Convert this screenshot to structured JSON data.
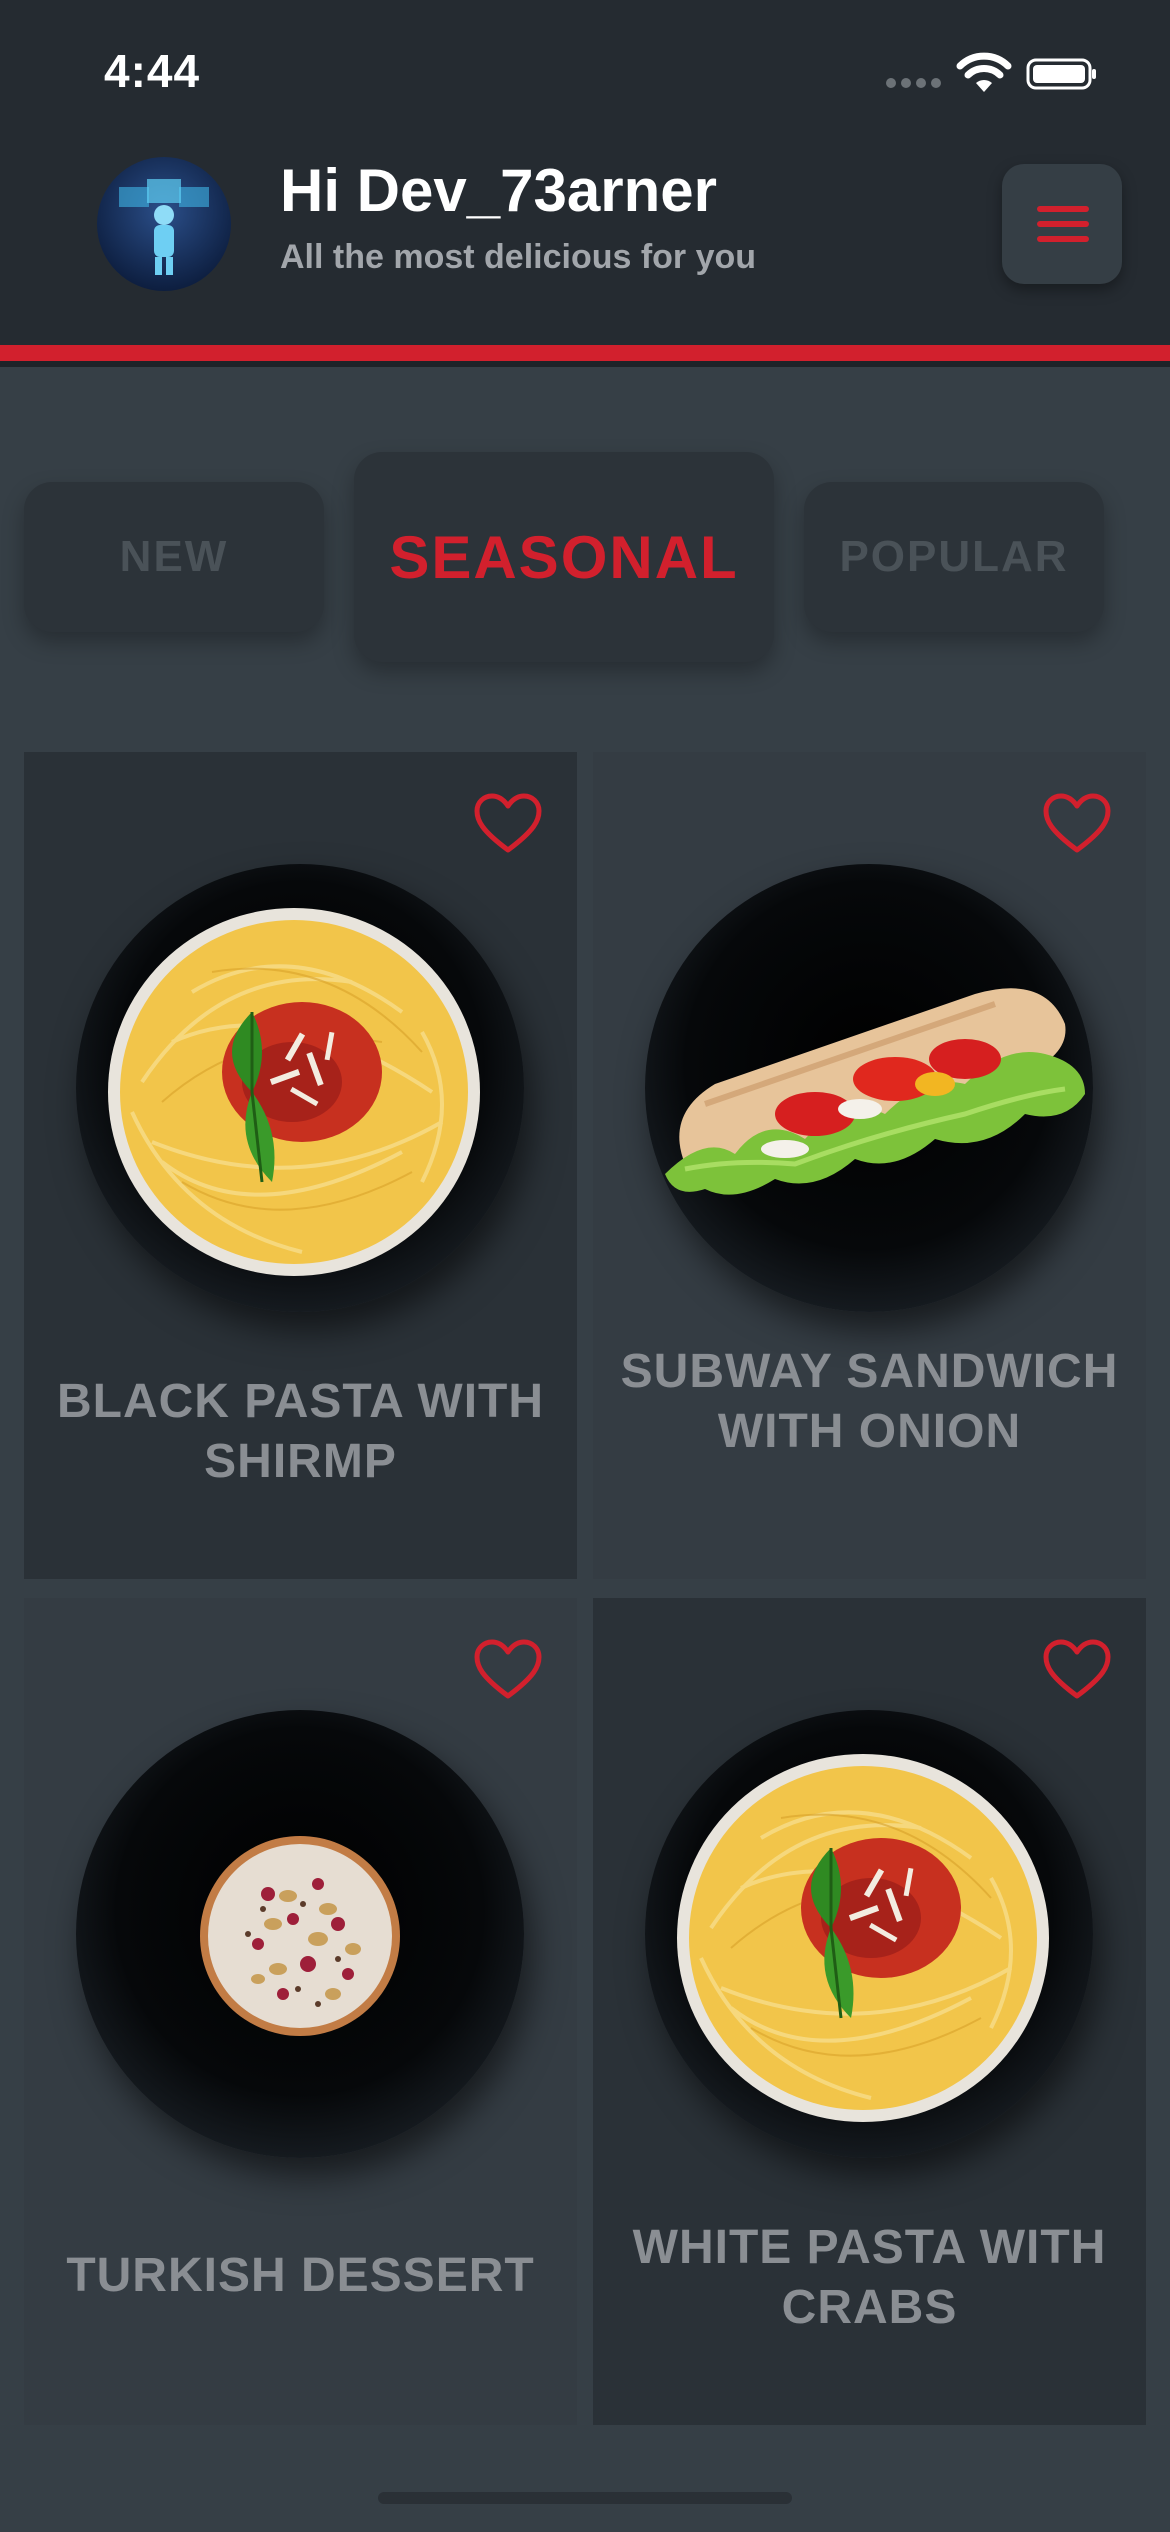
{
  "status_bar": {
    "time": "4:44"
  },
  "header": {
    "greeting": "Hi Dev_73arner",
    "subtitle": "All the most delicious for you",
    "accent_color": "#d2202d"
  },
  "tabs": [
    {
      "label": "NEW",
      "active": false
    },
    {
      "label": "SEASONAL",
      "active": true
    },
    {
      "label": "POPULAR",
      "active": false
    }
  ],
  "items": [
    {
      "title": "BLACK PASTA WITH SHIRMP",
      "image": "pasta-plate",
      "favorite_icon": "heart-outline-icon"
    },
    {
      "title": "SUBWAY SANDWICH WITH ONION",
      "image": "sandwich-plate",
      "favorite_icon": "heart-outline-icon"
    },
    {
      "title": "TURKISH DESSERT",
      "image": "dessert-bowl",
      "favorite_icon": "heart-outline-icon"
    },
    {
      "title": "WHITE PASTA WITH CRABS",
      "image": "pasta-plate",
      "favorite_icon": "heart-outline-icon"
    }
  ]
}
